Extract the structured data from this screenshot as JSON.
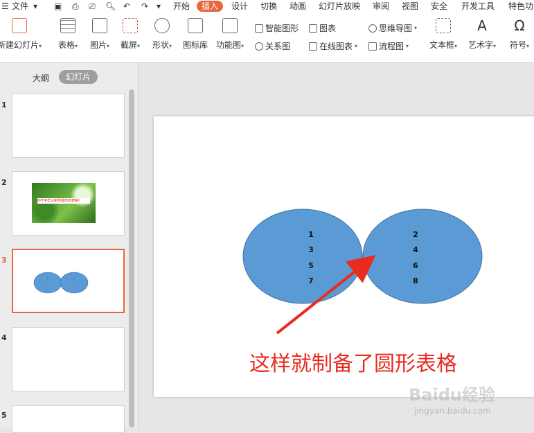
{
  "menu": {
    "file": "文件",
    "tabs": [
      "开始",
      "插入",
      "设计",
      "切换",
      "动画",
      "幻灯片放映",
      "审阅",
      "视图",
      "安全",
      "开发工具",
      "特色功"
    ],
    "active_index": 1,
    "active_color": "#e8663d"
  },
  "ribbon": {
    "new_slide": "新建幻灯片",
    "table": "表格",
    "picture": "图片",
    "screenshot": "截屏",
    "shape": "形状",
    "icon_lib": "图标库",
    "func_chart": "功能图",
    "smart_shape": "智能图形",
    "chart": "图表",
    "relation": "关系图",
    "online_chart": "在线图表",
    "mindmap": "思维导图",
    "flowchart": "流程图",
    "textbox": "文本框",
    "art_text": "艺术字",
    "symbol": "符号"
  },
  "panel": {
    "tab_outline": "大纲",
    "tab_slides": "幻灯片",
    "slides": [
      {
        "num": "1"
      },
      {
        "num": "2",
        "thumb_text": "PPT中怎么制作圆形的表格？"
      },
      {
        "num": "3",
        "selected": true
      },
      {
        "num": "4"
      },
      {
        "num": "5"
      }
    ]
  },
  "slide": {
    "left_circle": [
      "1",
      "3",
      "5",
      "7"
    ],
    "right_circle": [
      "2",
      "4",
      "6",
      "8"
    ],
    "circle_color": "#5b9bd5",
    "caption": "这样就制备了圆形表格",
    "caption_color": "#ea2b1f"
  },
  "watermark": {
    "logo": "Baidu经验",
    "url": "jingyan.baidu.com"
  }
}
